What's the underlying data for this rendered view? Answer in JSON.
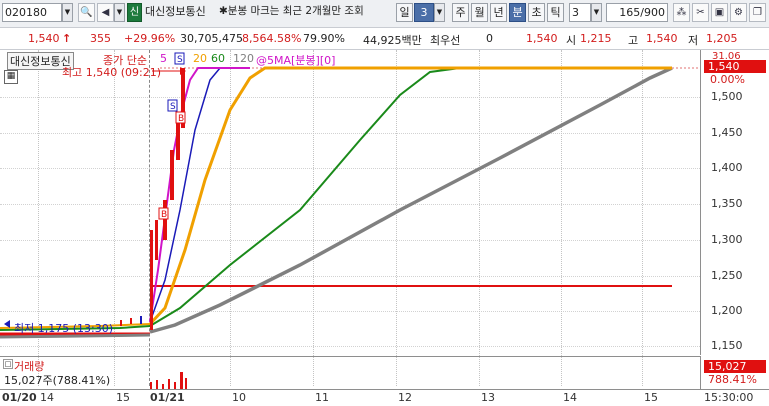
{
  "toolbar": {
    "code": "020180",
    "market_badge": "신",
    "stock_name": "대신정보통신",
    "notice": "✱분봉 마크는 최근 2개월만 조회",
    "period_label": "일",
    "period_value": "3",
    "tabs": [
      "주",
      "월",
      "년",
      "분",
      "초",
      "틱"
    ],
    "active_tab": "분",
    "interval_value": "3",
    "count_value": "165/900"
  },
  "quote": {
    "price": "1,540",
    "change": "355",
    "change_pct": "+29.96%",
    "volume": "30,705,475",
    "volume_pct": "8,564.58%",
    "ratio": "79.90%",
    "amount": "44,925백만",
    "priority_label": "최우선",
    "priority_value": "0",
    "bid_price": "1,540",
    "open_label": "시",
    "open_value": "1,215",
    "high_label": "고",
    "high_value": "1,540",
    "low_label": "저",
    "low_value": "1,205"
  },
  "legend": {
    "name": "대신정보통신",
    "series_label": "종가 단순",
    "ma": [
      "5",
      "20",
      "60",
      "120"
    ],
    "extra": "@5MA[분봉][0]"
  },
  "annotations": {
    "high_note": "최고 1,540 (09:21)",
    "low_note": "최저 1,175 (13:30)"
  },
  "price_axis": {
    "ticks": [
      "1,500",
      "1,450",
      "1,400",
      "1,350",
      "1,300",
      "1,250",
      "1,200",
      "1,150"
    ],
    "top_pct": "31.06",
    "current_price": "1,540",
    "current_pct": "0.00%"
  },
  "volume": {
    "title": "거래량",
    "value_text": "15,027주(788.41%)",
    "axis_value": "15,027",
    "axis_pct": "788.41%"
  },
  "time_axis": {
    "labels": [
      "01/20",
      "14",
      "15",
      "01/21",
      "10",
      "11",
      "12",
      "13",
      "14",
      "15"
    ],
    "cursor_time": "15:30:00"
  },
  "colors": {
    "up": "#d21c1c",
    "ma5": "#d014c8",
    "ma20": "#f0a000",
    "ma60": "#1a8a1a",
    "ma120": "#808080",
    "line_blue": "#1a1ab8"
  }
}
